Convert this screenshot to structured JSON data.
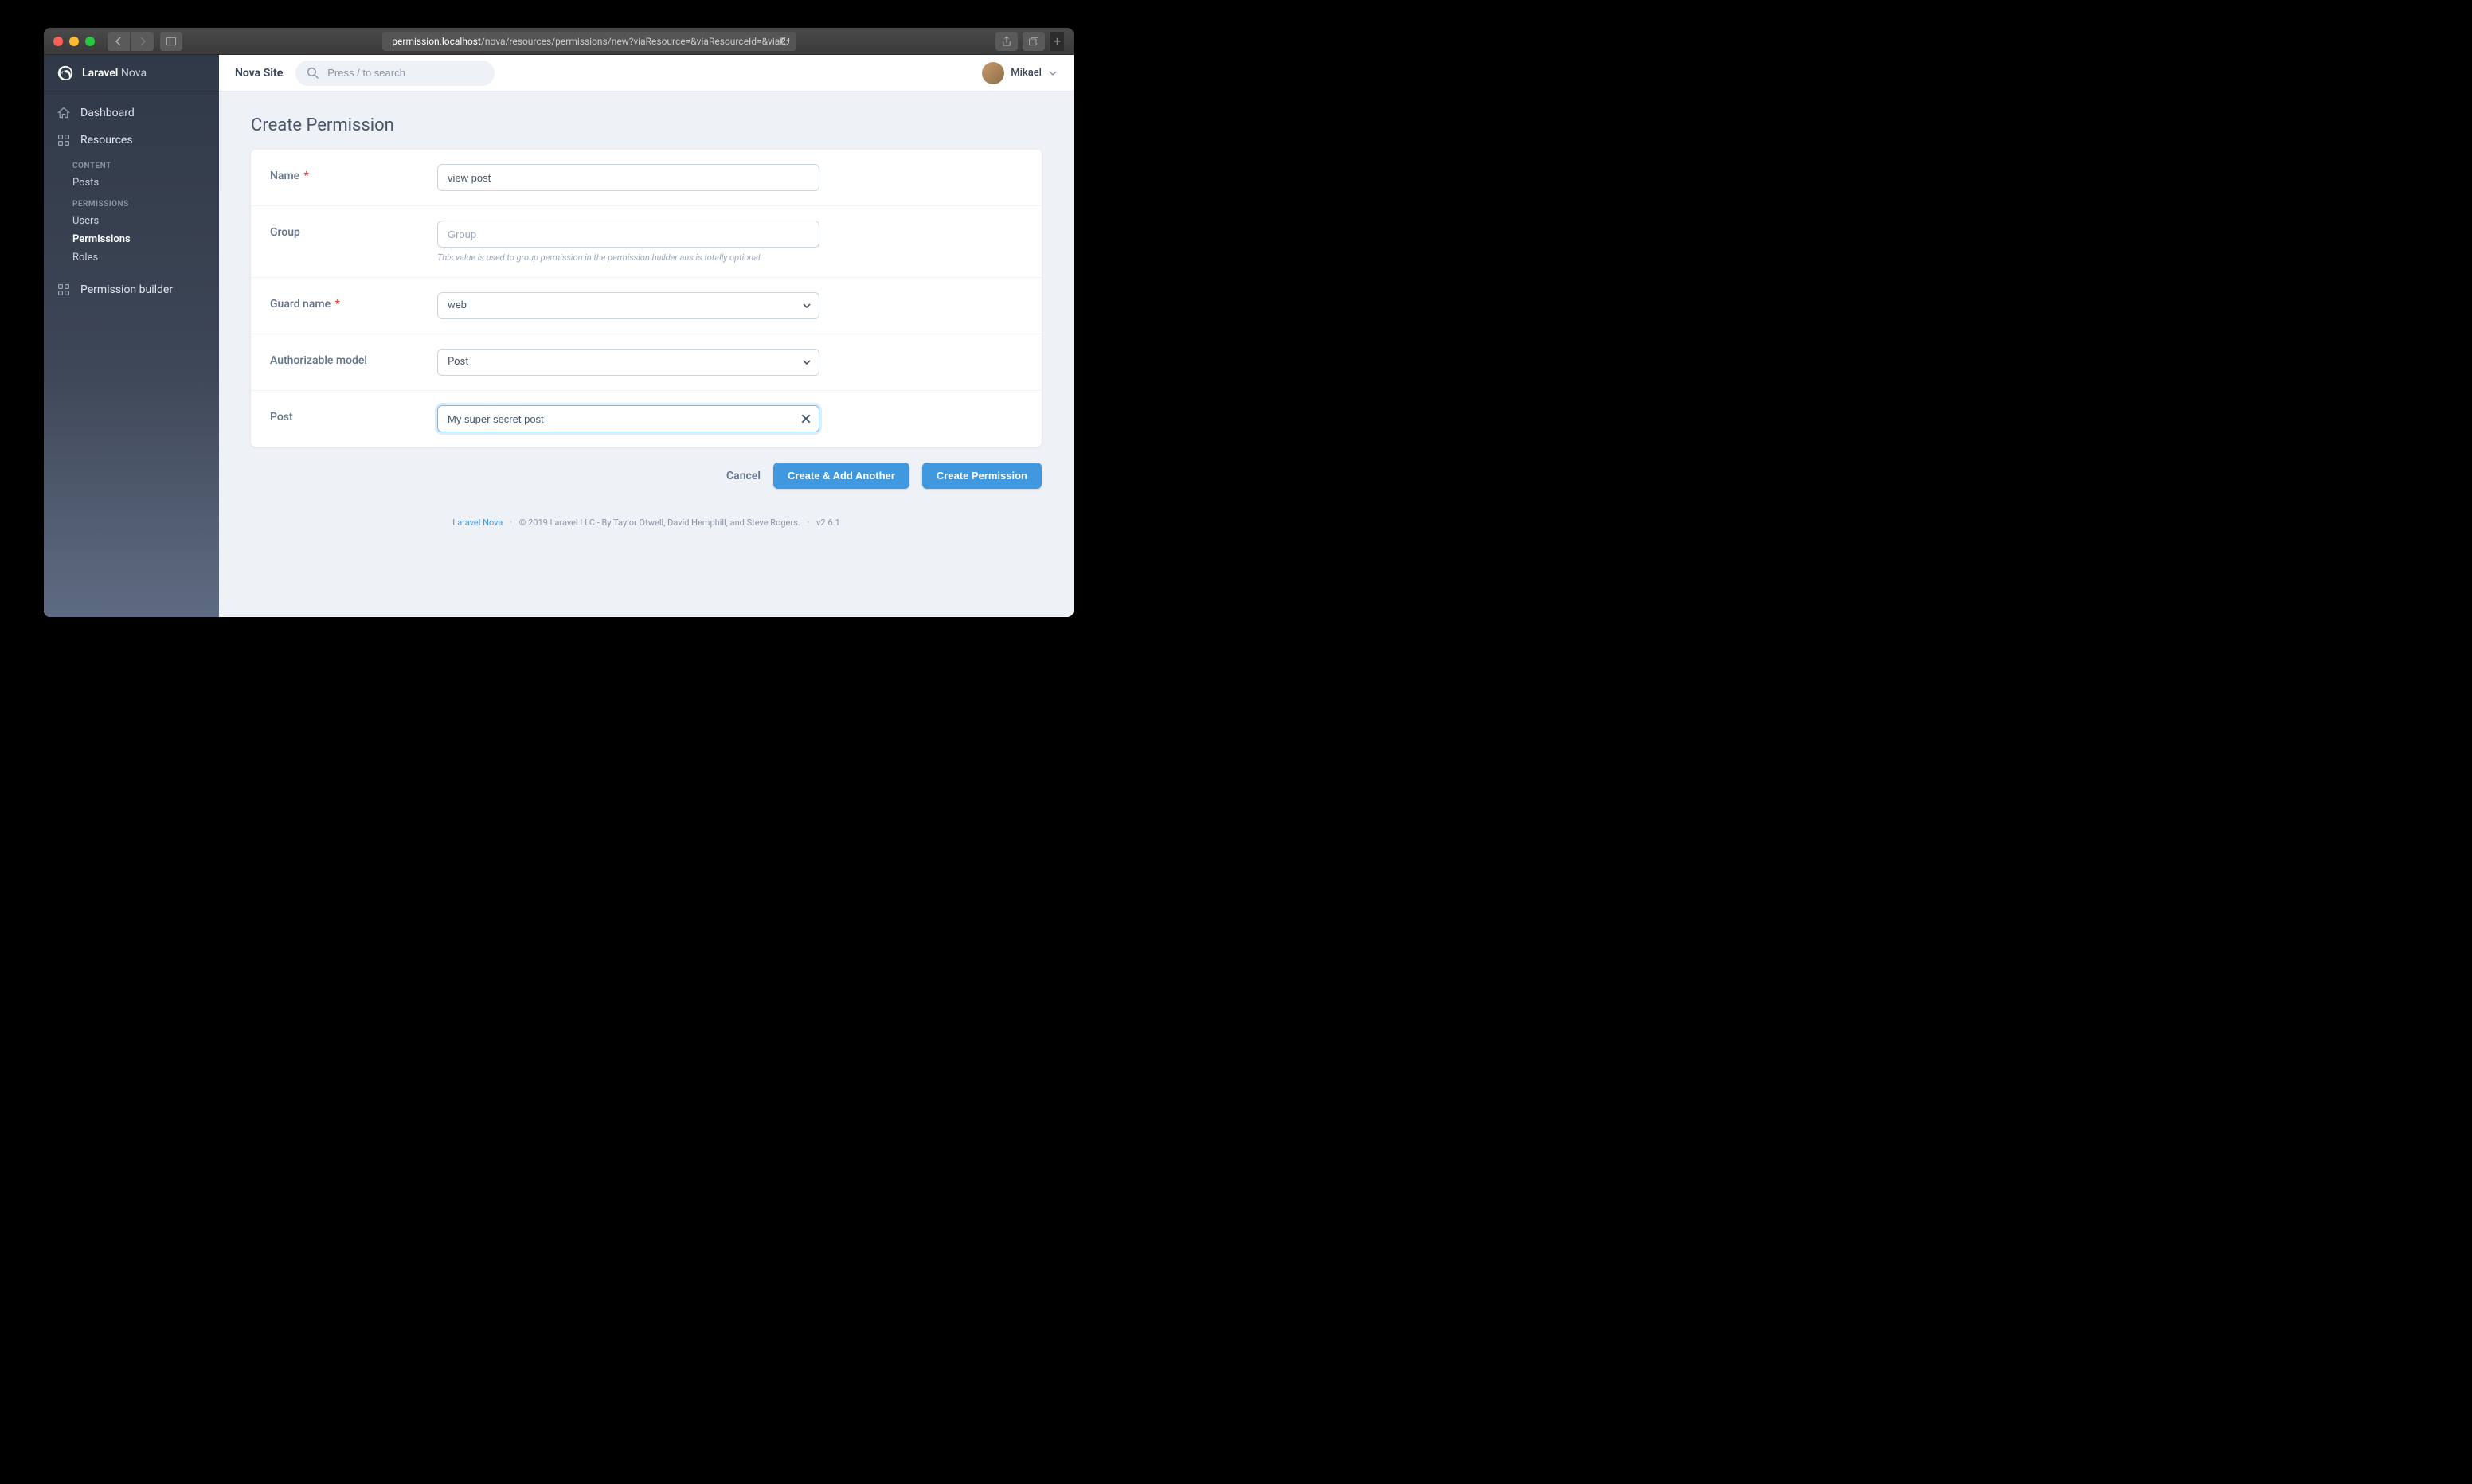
{
  "browser": {
    "url_prefix": "permission.localhost",
    "url_rest": "/nova/resources/permissions/new?viaResource=&viaResourceId=&viaR"
  },
  "brand": {
    "name": "Laravel",
    "suffix": "Nova"
  },
  "sidebar": {
    "dashboard": "Dashboard",
    "resources": "Resources",
    "group_content": "CONTENT",
    "posts": "Posts",
    "group_permissions": "PERMISSIONS",
    "users": "Users",
    "permissions": "Permissions",
    "roles": "Roles",
    "permission_builder": "Permission builder"
  },
  "topbar": {
    "site": "Nova Site",
    "search_placeholder": "Press / to search",
    "user": "Mikael"
  },
  "page": {
    "title": "Create Permission"
  },
  "form": {
    "name": {
      "label": "Name",
      "value": "view post"
    },
    "group": {
      "label": "Group",
      "placeholder": "Group",
      "help": "This value is used to group permission in the permission builder ans is totally optional."
    },
    "guard": {
      "label": "Guard name",
      "value": "web"
    },
    "model": {
      "label": "Authorizable model",
      "value": "Post"
    },
    "post": {
      "label": "Post",
      "value": "My super secret post"
    }
  },
  "actions": {
    "cancel": "Cancel",
    "create_another": "Create & Add Another",
    "create": "Create Permission"
  },
  "footer": {
    "link": "Laravel Nova",
    "copy": "© 2019 Laravel LLC - By Taylor Otwell, David Hemphill, and Steve Rogers.",
    "version": "v2.6.1"
  }
}
